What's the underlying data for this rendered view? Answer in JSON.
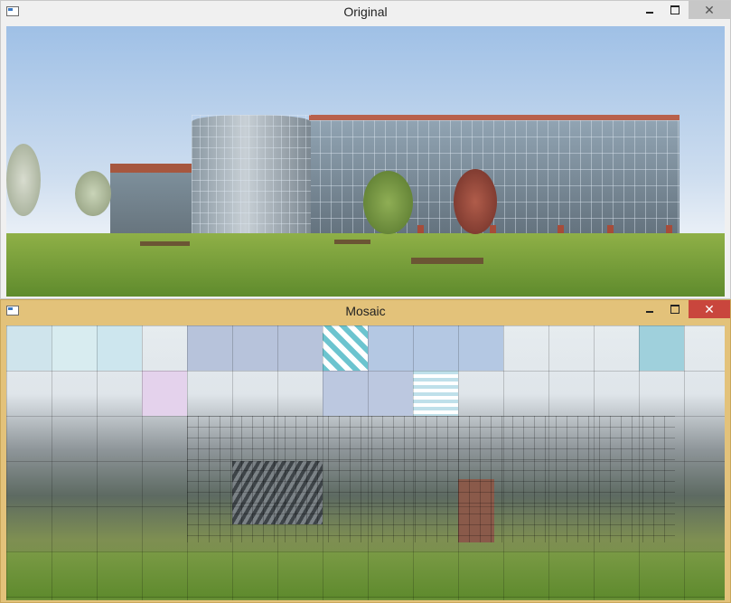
{
  "windows": [
    {
      "title": "Original"
    },
    {
      "title": "Mosaic"
    }
  ],
  "controls": {
    "close_glyph": "✕"
  }
}
